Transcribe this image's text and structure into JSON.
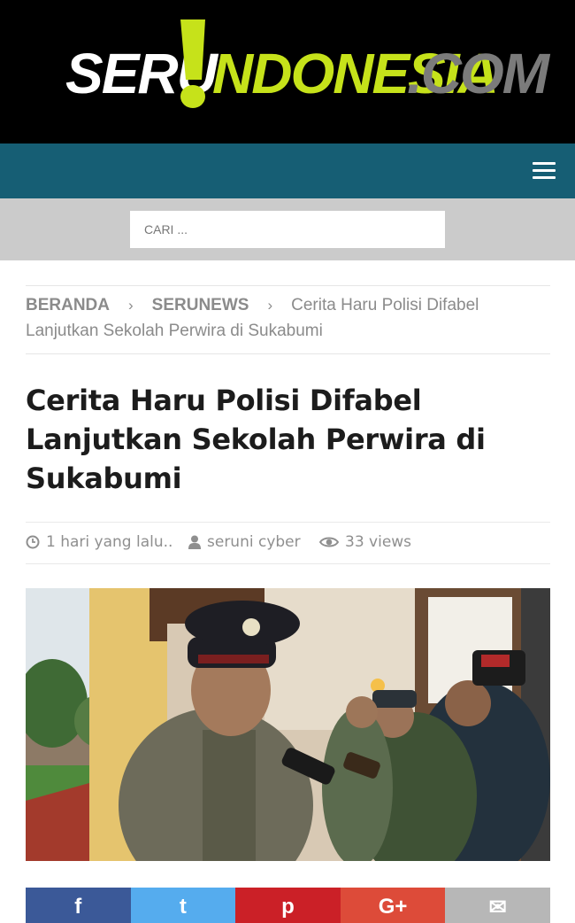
{
  "header": {
    "logo": {
      "part1": "SERU",
      "part2": "NDONESIA",
      "part3": ".COM"
    }
  },
  "nav": {
    "menu_icon": "hamburger-menu-icon"
  },
  "search": {
    "placeholder": "CARI ..."
  },
  "breadcrumb": {
    "home": "BERANDA",
    "category": "SERUNEWS",
    "current_line1": "Cerita Haru Polisi Difabel",
    "current_line2": "Lanjutkan Sekolah Perwira di Sukabumi",
    "separator_icon": "chevron-right-icon"
  },
  "article": {
    "title": "Cerita Haru Polisi Difabel Lanjutkan Sekolah Perwira di Sukabumi",
    "time": "1 hari yang lalu..",
    "author": "seruni cyber",
    "views": "33 views"
  },
  "share": {
    "buttons": [
      {
        "name": "facebook",
        "glyph": "f",
        "color": "#3b5998"
      },
      {
        "name": "twitter",
        "glyph": "t",
        "color": "#55acee"
      },
      {
        "name": "pinterest",
        "glyph": "p",
        "color": "#cb2027"
      },
      {
        "name": "google-plus",
        "glyph": "G+",
        "color": "#dd4b39"
      },
      {
        "name": "email",
        "glyph": "✉",
        "color": "#b7b7b7"
      }
    ]
  }
}
